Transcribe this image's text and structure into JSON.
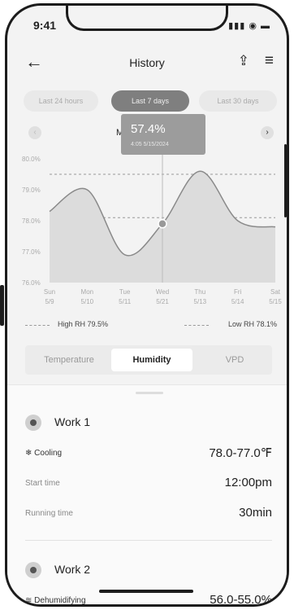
{
  "status_bar": {
    "time": "9:41",
    "icons": "▮▮▮ ◉ ▬"
  },
  "header": {
    "title": "History",
    "back_icon": "←",
    "share_icon": "⇪",
    "menu_icon": "≡"
  },
  "ranges": [
    {
      "label": "Last 24 hours",
      "active": false
    },
    {
      "label": "Last 7 days",
      "active": true
    },
    {
      "label": "Last 30 days",
      "active": false
    }
  ],
  "month_peek": "M",
  "tooltip": {
    "value": "57.4%",
    "datetime": "4:05 5/15/2024"
  },
  "chart_data": {
    "type": "area",
    "y_ticks": [
      "80.0%",
      "79.0%",
      "78.0%",
      "77.0%",
      "76.0%"
    ],
    "ylim": [
      76.0,
      80.0
    ],
    "x_labels": [
      {
        "day": "Sun",
        "date": "5/9"
      },
      {
        "day": "Mon",
        "date": "5/10"
      },
      {
        "day": "Tue",
        "date": "5/11"
      },
      {
        "day": "Wed",
        "date": "5/21"
      },
      {
        "day": "Thu",
        "date": "5/13"
      },
      {
        "day": "Fri",
        "date": "5/14"
      },
      {
        "day": "Sat",
        "date": "5/15"
      }
    ],
    "values": [
      78.3,
      79.0,
      76.9,
      77.9,
      79.6,
      78.0,
      77.8
    ],
    "high_line": 79.5,
    "low_line": 78.1,
    "highlight_index": 3
  },
  "legend": {
    "high": "High RH 79.5%",
    "low": "Low RH 78.1%"
  },
  "tabs": [
    {
      "label": "Temperature",
      "active": false
    },
    {
      "label": "Humidity",
      "active": true
    },
    {
      "label": "VPD",
      "active": false
    }
  ],
  "works": [
    {
      "title": "Work 1",
      "mode_icon": "❄",
      "mode": "Cooling",
      "mode_value": "78.0-77.0℉",
      "start_label": "Start time",
      "start_value": "12:00pm",
      "running_label": "Running time",
      "running_value": "30min"
    },
    {
      "title": "Work 2",
      "mode_icon": "≋",
      "mode": "Dehumidifying",
      "mode_value": "56.0-55.0%"
    }
  ],
  "colors": {
    "accent": "#7f7f7f",
    "fill": "#dcdcdc",
    "line": "#8a8a8a"
  }
}
